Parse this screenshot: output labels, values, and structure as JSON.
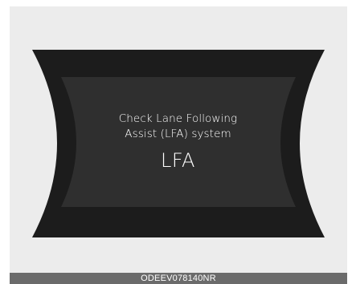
{
  "display": {
    "message_line1": "Check Lane Following",
    "message_line2": "Assist (LFA) system",
    "indicator_code": "LFA"
  },
  "caption": {
    "image_code": "ODEEV078140NR"
  },
  "colors": {
    "background": "#ececec",
    "panel_dark": "#1c1c1c",
    "panel_inner": "#2e2e2e",
    "text": "#ffffff",
    "caption_bar": "#6b6b6b"
  }
}
